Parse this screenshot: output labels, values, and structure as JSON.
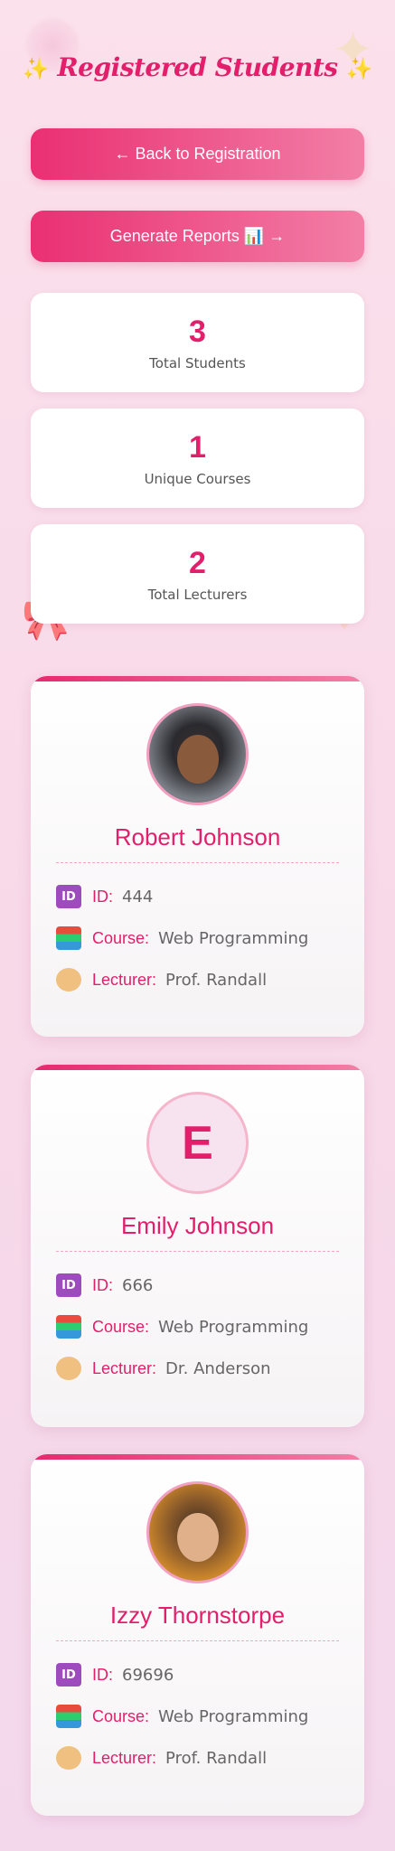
{
  "page": {
    "title": "Registered Students",
    "title_left_sparkle": "✨",
    "title_right_sparkle": "✨"
  },
  "buttons": {
    "back": "← Back to Registration",
    "generate": "Generate Reports 📊 →"
  },
  "stats": [
    {
      "value": "3",
      "label": "Total Students"
    },
    {
      "value": "1",
      "label": "Unique Courses"
    },
    {
      "value": "2",
      "label": "Total Lecturers"
    }
  ],
  "labels": {
    "id": "ID:",
    "course": "Course:",
    "lecturer": "Lecturer:"
  },
  "icons": {
    "id": "ID",
    "book": "",
    "teacher": ""
  },
  "students": [
    {
      "name": "Robert Johnson",
      "id": "444",
      "course": "Web Programming",
      "lecturer": "Prof. Randall",
      "avatar": "photo"
    },
    {
      "name": "Emily Johnson",
      "id": "666",
      "course": "Web Programming",
      "lecturer": "Dr. Anderson",
      "avatar": "E"
    },
    {
      "name": "Izzy Thornstorpe",
      "id": "69696",
      "course": "Web Programming",
      "lecturer": "Prof. Randall",
      "avatar": "photo"
    }
  ],
  "colors": {
    "accent": "#e31e6a",
    "button_gradient_start": "#ea2f72",
    "button_gradient_end": "#f27fa6",
    "background": "#fbe1ec"
  }
}
